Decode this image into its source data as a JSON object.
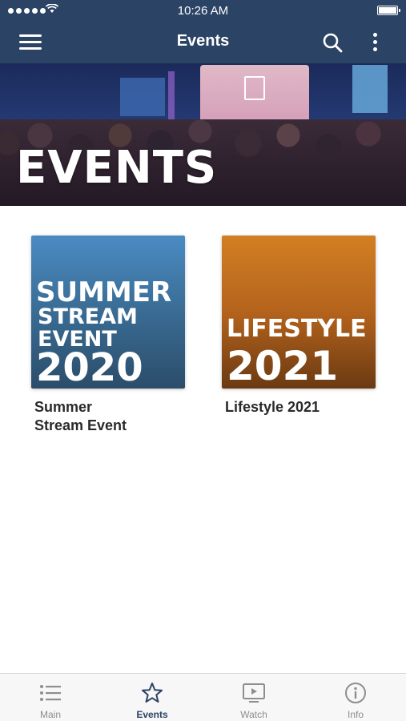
{
  "status_bar": {
    "time": "10:26 AM"
  },
  "nav": {
    "title": "Events"
  },
  "hero": {
    "title": "EVENTS"
  },
  "events": [
    {
      "thumb_lines": [
        "SUMMER",
        "STREAM",
        "EVENT",
        "2020"
      ],
      "label_line1": "Summer",
      "label_line2": "Stream Event"
    },
    {
      "thumb_lines": [
        "LIFESTYLE",
        "2021"
      ],
      "label_line1": "Lifestyle 2021"
    }
  ],
  "tabs": [
    {
      "label": "Main",
      "icon": "list-icon"
    },
    {
      "label": "Events",
      "icon": "star-icon"
    },
    {
      "label": "Watch",
      "icon": "video-icon"
    },
    {
      "label": "Info",
      "icon": "info-icon"
    }
  ],
  "colors": {
    "nav_bg": "#2b4364",
    "active_tab": "#2b4364",
    "inactive_tab": "#8e8e8e",
    "summer_card": "#3b6f98",
    "lifestyle_card": "#b4631c"
  }
}
